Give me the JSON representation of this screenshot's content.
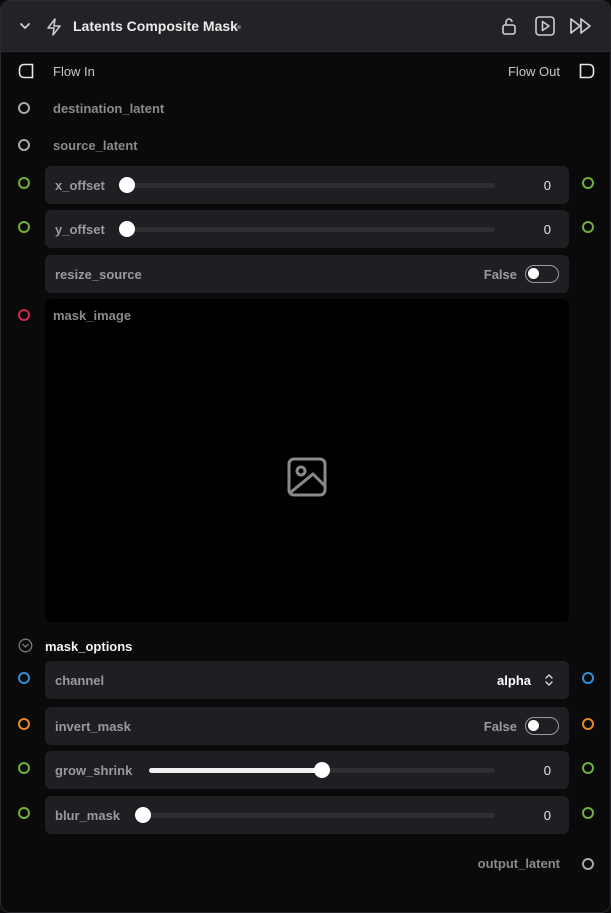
{
  "colors": {
    "port_gray": "#a9a9ad",
    "port_green": "#6fb03a",
    "port_red": "#d0264a",
    "port_blue": "#2f8fd6",
    "port_orange": "#e08a2a"
  },
  "header": {
    "title": "Latents Composite Mask",
    "collapse_icon": "chevron-down-icon",
    "type_icon": "lightning-icon",
    "buttons": [
      "unlock-icon",
      "play-icon",
      "fast-forward-icon"
    ]
  },
  "flow": {
    "in_label": "Flow In",
    "out_label": "Flow Out"
  },
  "inputs": {
    "destination_latent": "destination_latent",
    "source_latent": "source_latent"
  },
  "x_offset": {
    "label": "x_offset",
    "value": "0",
    "fraction": 0.0
  },
  "y_offset": {
    "label": "y_offset",
    "value": "0",
    "fraction": 0.0
  },
  "resize_source": {
    "label": "resize_source",
    "value": "False"
  },
  "mask_image": {
    "label": "mask_image",
    "placeholder_icon": "image-placeholder-icon"
  },
  "mask_options": {
    "title": "mask_options",
    "channel": {
      "label": "channel",
      "value": "alpha"
    },
    "invert_mask": {
      "label": "invert_mask",
      "value": "False"
    },
    "grow_shrink": {
      "label": "grow_shrink",
      "value": "0",
      "fraction": 0.5
    },
    "blur_mask": {
      "label": "blur_mask",
      "value": "0",
      "fraction": 0.0
    }
  },
  "output": {
    "label": "output_latent"
  }
}
